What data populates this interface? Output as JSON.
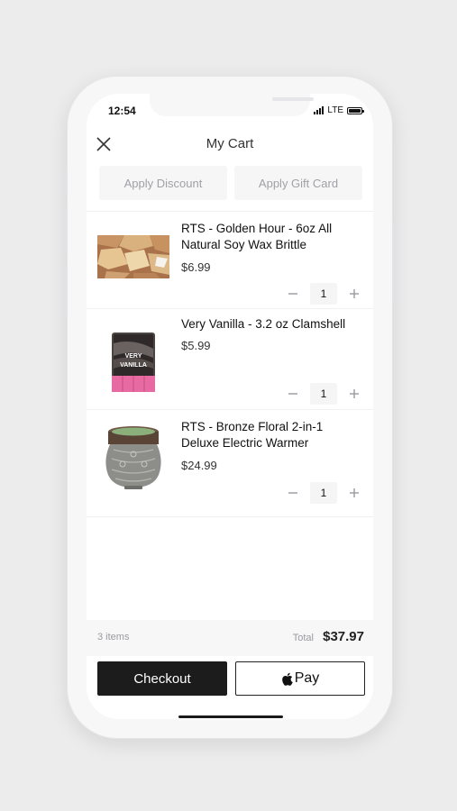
{
  "status_bar": {
    "time": "12:54",
    "network": "LTE"
  },
  "header": {
    "title": "My Cart",
    "close_icon": "close-icon"
  },
  "promo": {
    "discount_label": "Apply Discount",
    "gift_card_label": "Apply Gift Card"
  },
  "cart": {
    "items": [
      {
        "name": "RTS - Golden Hour - 6oz All Natural Soy Wax Brittle",
        "price": "$6.99",
        "quantity": "1"
      },
      {
        "name": "Very Vanilla - 3.2 oz Clamshell",
        "price": "$5.99",
        "quantity": "1",
        "package_text": "VERY VANILLA"
      },
      {
        "name": "RTS - Bronze Floral  2-in-1 Deluxe Electric Warmer",
        "price": "$24.99",
        "quantity": "1"
      }
    ]
  },
  "summary": {
    "items_count": "3 items",
    "total_label": "Total",
    "total_value": "$37.97"
  },
  "actions": {
    "checkout_label": "Checkout",
    "apple_pay_label": "Pay"
  },
  "colors": {
    "checkout_bg": "#1c1c1c",
    "background": "#ececec",
    "muted_text": "#a0a0a6"
  }
}
